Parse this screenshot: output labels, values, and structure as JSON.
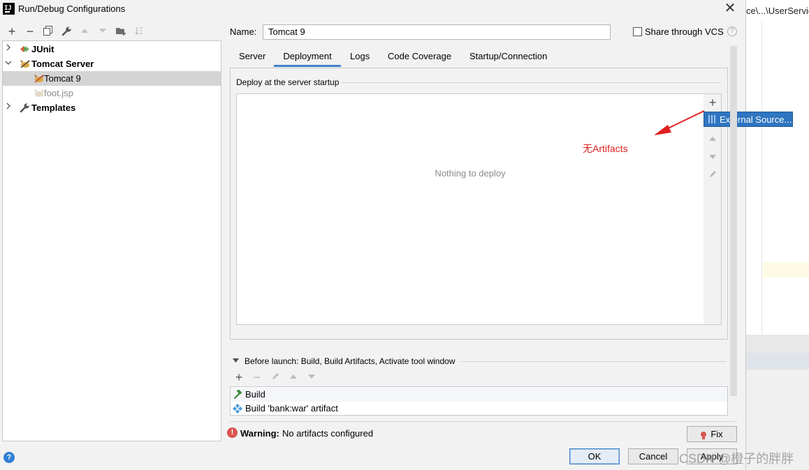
{
  "window": {
    "title": "Run/Debug Configurations",
    "close": "✕"
  },
  "background_ide": {
    "breadcrumb": "ce\\...\\UserServic"
  },
  "toolbar": {
    "icons": [
      "plus-icon",
      "minus-icon",
      "copy-icon",
      "wrench-icon",
      "arrow-up-icon",
      "arrow-down-icon",
      "folder-add-icon",
      "sort-icon"
    ]
  },
  "tree": {
    "items": [
      {
        "label": "JUnit"
      },
      {
        "label": "Tomcat Server"
      },
      {
        "label": "Tomcat 9"
      },
      {
        "label": "foot.jsp"
      },
      {
        "label": "Templates"
      }
    ]
  },
  "name_field": {
    "label": "Name:",
    "value": "Tomcat 9"
  },
  "share": {
    "label": "Share through VCS",
    "checked": false,
    "help": "?"
  },
  "tabs": [
    {
      "label": "Server"
    },
    {
      "label": "Deployment"
    },
    {
      "label": "Logs"
    },
    {
      "label": "Code Coverage"
    },
    {
      "label": "Startup/Connection"
    }
  ],
  "deployment": {
    "legend": "Deploy at the server startup",
    "empty_text": "Nothing to deploy",
    "add": "+",
    "popup_item": "External Source..."
  },
  "annotation": {
    "text": "无Artifacts",
    "color": "#e02020"
  },
  "before_launch": {
    "label": "Before launch: Build, Build Artifacts, Activate tool window",
    "items": [
      {
        "label": "Build"
      },
      {
        "label": "Build 'bank:war' artifact"
      }
    ]
  },
  "warning": {
    "prefix": "Warning:",
    "text": "No artifacts configured",
    "icon": "!"
  },
  "buttons": {
    "fix": "Fix",
    "ok": "OK",
    "cancel": "Cancel",
    "apply": "Apply",
    "help": "?"
  },
  "watermark": "CSDN @橙子的胖胖",
  "colors": {
    "accent": "#4083c9",
    "popup": "#2f75c0",
    "warning": "#d9534f"
  }
}
